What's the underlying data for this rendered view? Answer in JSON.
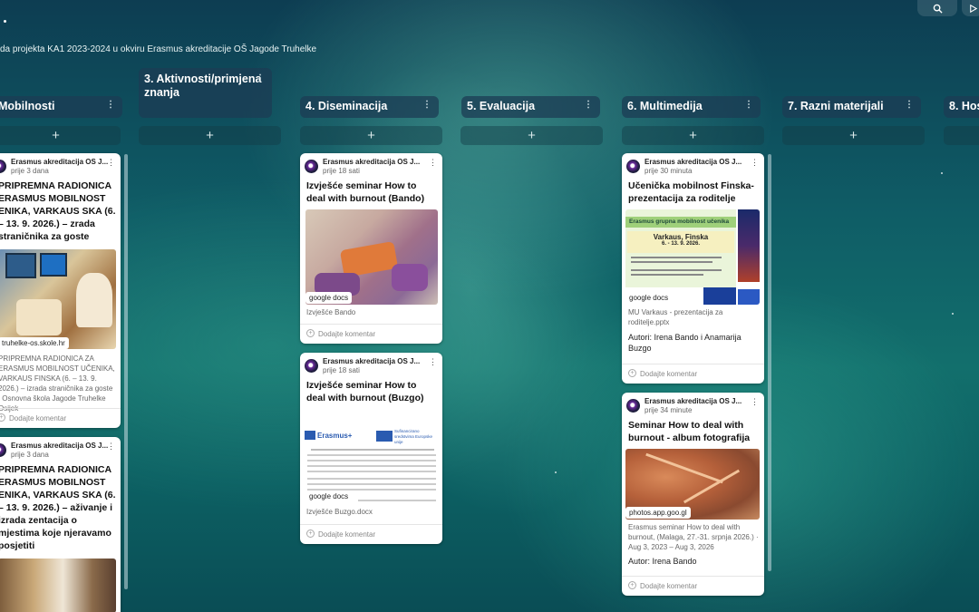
{
  "board": {
    "subtitle": "da projekta KA1 2023-2024 u okviru Erasmus akreditacije OŠ Jagode Truhelke"
  },
  "columns": [
    {
      "title": "Mobilnosti",
      "add": "+"
    },
    {
      "title": "3. Aktivnosti/primjena znanja",
      "add": "+"
    },
    {
      "title": "4. Diseminacija",
      "add": "+"
    },
    {
      "title": "5. Evaluacija",
      "add": "+"
    },
    {
      "title": "6. Multimedija",
      "add": "+"
    },
    {
      "title": "7. Razni materijali",
      "add": "+"
    },
    {
      "title": "8. Hos",
      "add": "+"
    }
  ],
  "comment_label": "Dodajte komentar",
  "comment_label_cut": "Dodajte komentar",
  "cards": {
    "m1": {
      "author": "Erasmus akreditacija OS J...",
      "time": "prije 3 dana",
      "title": "PRIPREMNA RADIONICA ERASMUS MOBILNOST ENIKA, VARKAUS SKA (6. – 13. 9. 2026.) – zrada straničnika za goste",
      "chip": "truhelke-os.skole.hr",
      "desc": "PRIPREMNA RADIONICA ZA ERASMUS MOBILNOST UČENIKA, VARKAUS FINSKA (6. – 13. 9. 2026.) – izrada straničnika za goste | Osnovna škola Jagode Truhelke Osijek"
    },
    "m2": {
      "author": "Erasmus akreditacija OS J...",
      "time": "prije 3 dana",
      "title": "PRIPREMNA RADIONICA ERASMUS MOBILNOST ENIKA, VARKAUS SKA (6. – 13. 9. 2026.) – aživanje i izrada zentacija o mjestima koje njeravamo posjetiti"
    },
    "d1": {
      "author": "Erasmus akreditacija OS J...",
      "time": "prije 18 sati",
      "title": "Izvješće seminar How to deal with burnout (Bando)",
      "chip": "google docs",
      "file": "Izvješće Bando"
    },
    "d2": {
      "author": "Erasmus akreditacija OS J...",
      "time": "prije 18 sati",
      "title": "Izvješće seminar How to deal with burnout (Buzgo)",
      "chip": "google docs",
      "file": "Izvješće Buzgo.docx",
      "doc_logo_left": "Erasmus+",
      "doc_logo_right": "Sufinancirano sredstvima Europske unije"
    },
    "mm1": {
      "author": "Erasmus akreditacija OS J...",
      "time": "prije 30 minuta",
      "title": "Učenička mobilnost Finska- prezentacija za roditelje",
      "slide_head": "Erasmus grupna mobilnost učenika",
      "slide_title": "Varkaus, Finska",
      "slide_date": "6. - 13. 9. 2026.",
      "chip": "google docs",
      "file": "MU Varkaus - prezentacija za roditelje.pptx",
      "authors": "Autori: Irena Bando i Anamarija Buzgo"
    },
    "mm2": {
      "author": "Erasmus akreditacija OS J...",
      "time": "prije 34 minute",
      "title": "Seminar How to deal with burnout - album fotografija",
      "chip": "photos.app.goo.gl",
      "desc": "Erasmus seminar How to deal with burnout, (Malaga, 27.-31. srpnja 2026.) · Aug 3, 2023 – Aug 3, 2026",
      "authors": "Autor: Irena Bando"
    }
  }
}
